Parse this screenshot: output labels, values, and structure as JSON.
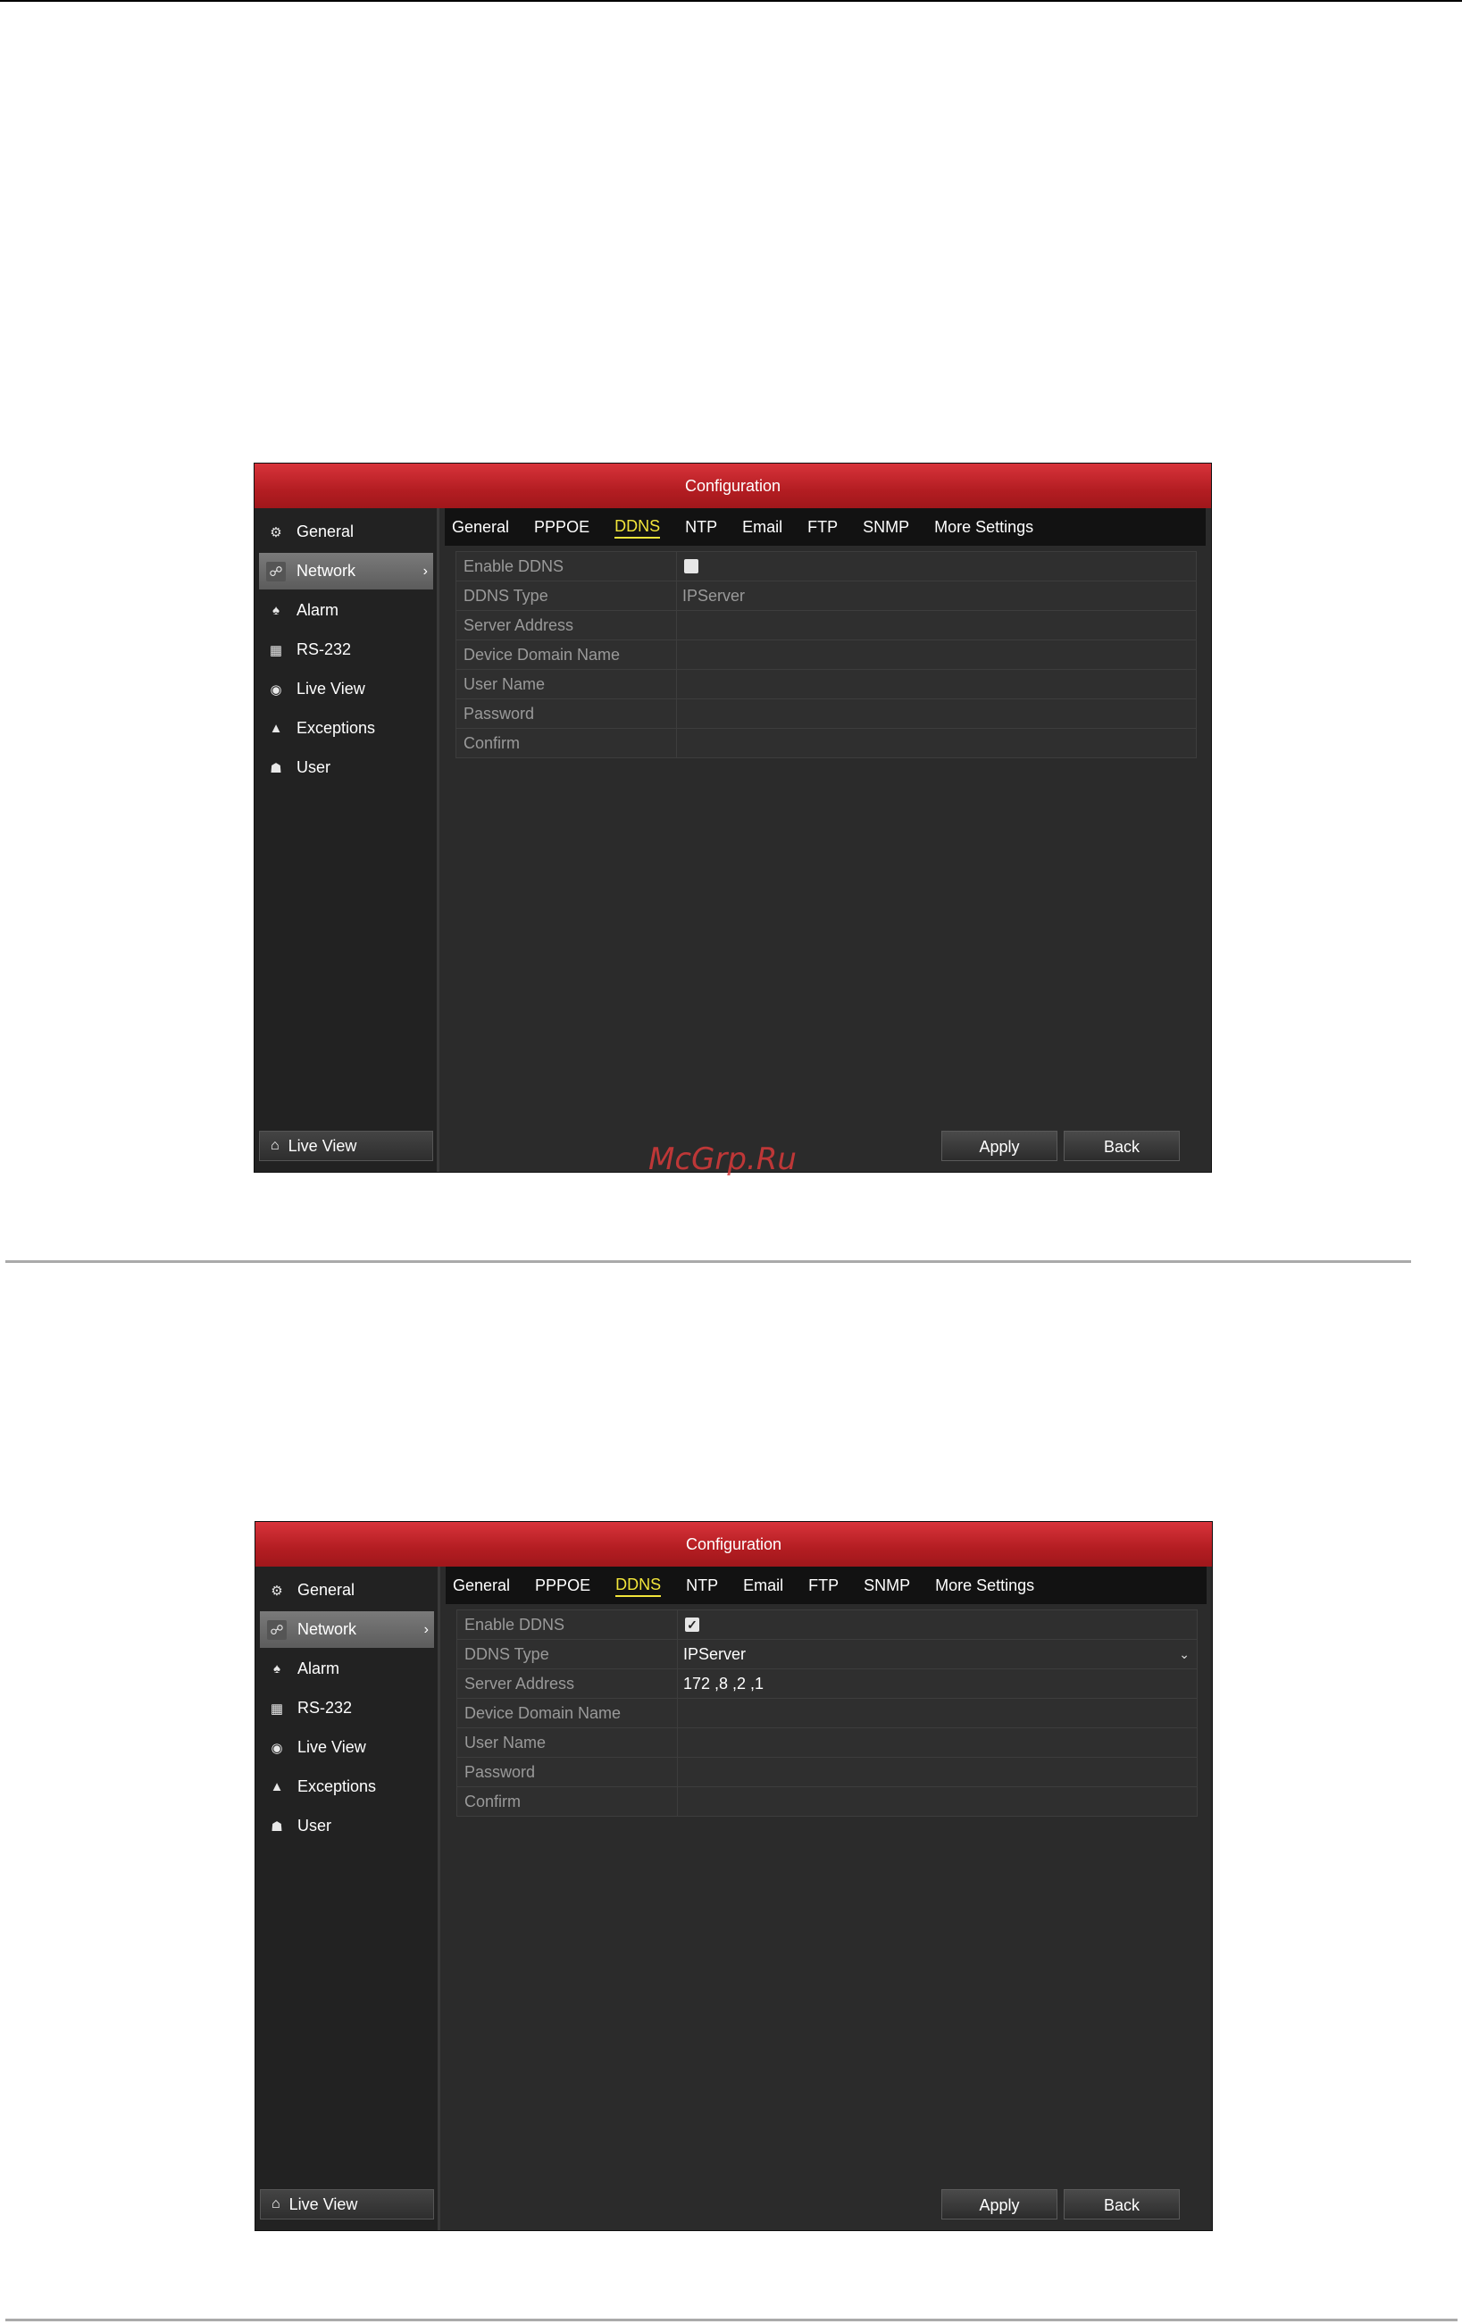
{
  "watermark": "McGrp.Ru",
  "screens": [
    {
      "title": "Configuration",
      "sidebar": {
        "items": [
          {
            "label": "General",
            "icon": "gear-icon"
          },
          {
            "label": "Network",
            "icon": "network-icon",
            "active": true
          },
          {
            "label": "Alarm",
            "icon": "bell-icon"
          },
          {
            "label": "RS-232",
            "icon": "serial-port-icon"
          },
          {
            "label": "Live View",
            "icon": "eye-icon"
          },
          {
            "label": "Exceptions",
            "icon": "warning-icon"
          },
          {
            "label": "User",
            "icon": "users-icon"
          }
        ],
        "footer_label": "Live View"
      },
      "tabs": [
        "General",
        "PPPOE",
        "DDNS",
        "NTP",
        "Email",
        "FTP",
        "SNMP",
        "More Settings"
      ],
      "active_tab": "DDNS",
      "form": {
        "enable_ddns": {
          "label": "Enable DDNS",
          "checked": false
        },
        "ddns_type": {
          "label": "DDNS Type",
          "value": "IPServer"
        },
        "server_address": {
          "label": "Server Address",
          "value": ""
        },
        "device_domain_name": {
          "label": "Device Domain Name",
          "value": ""
        },
        "user_name": {
          "label": "User Name",
          "value": ""
        },
        "password": {
          "label": "Password",
          "value": ""
        },
        "confirm": {
          "label": "Confirm",
          "value": ""
        }
      },
      "buttons": {
        "apply": "Apply",
        "back": "Back"
      }
    },
    {
      "title": "Configuration",
      "sidebar": {
        "items": [
          {
            "label": "General",
            "icon": "gear-icon"
          },
          {
            "label": "Network",
            "icon": "network-icon",
            "active": true
          },
          {
            "label": "Alarm",
            "icon": "bell-icon"
          },
          {
            "label": "RS-232",
            "icon": "serial-port-icon"
          },
          {
            "label": "Live View",
            "icon": "eye-icon"
          },
          {
            "label": "Exceptions",
            "icon": "warning-icon"
          },
          {
            "label": "User",
            "icon": "users-icon"
          }
        ],
        "footer_label": "Live View"
      },
      "tabs": [
        "General",
        "PPPOE",
        "DDNS",
        "NTP",
        "Email",
        "FTP",
        "SNMP",
        "More Settings"
      ],
      "active_tab": "DDNS",
      "form": {
        "enable_ddns": {
          "label": "Enable DDNS",
          "checked": true
        },
        "ddns_type": {
          "label": "DDNS Type",
          "value": "IPServer"
        },
        "server_address": {
          "label": "Server Address",
          "value": "172 ,8 ,2 ,1"
        },
        "device_domain_name": {
          "label": "Device Domain Name",
          "value": ""
        },
        "user_name": {
          "label": "User Name",
          "value": ""
        },
        "password": {
          "label": "Password",
          "value": ""
        },
        "confirm": {
          "label": "Confirm",
          "value": ""
        }
      },
      "buttons": {
        "apply": "Apply",
        "back": "Back"
      }
    }
  ]
}
